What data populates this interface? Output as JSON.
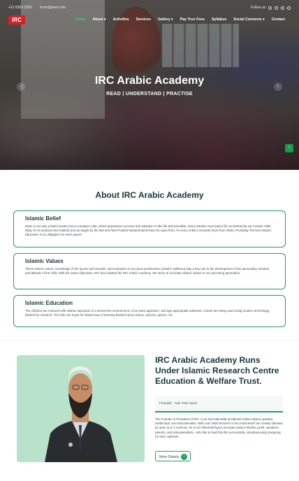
{
  "topbar": {
    "phone": "+91 8369 2350",
    "email": "ircsm@web.com",
    "follow_label": "Follow us"
  },
  "nav": {
    "logo_text": "IRC",
    "items": [
      "Home",
      "About ▾",
      "Activities",
      "Services",
      "Gallery ▾",
      "Pay Your Fees",
      "Syllabus",
      "Social Connects ▾",
      "Contact"
    ]
  },
  "hero": {
    "title": "IRC Arabic Academy",
    "subtitle": "READ | UNDERSTAND | PRACTISE",
    "prev": "‹",
    "next": "›",
    "scroll_top": "↑"
  },
  "about": {
    "title": "About IRC Arabic Academy",
    "cards": [
      {
        "title": "Islamic Belief",
        "text": "Islam is not only a belief system but a complete code, which guarantees success and salvation in this life and hereafter. Every Muslim must lead a life as desired by our Creator Allah (May He be praised and exalted) and as taught by the last and final Prophet Muhammad (Peace be upon him). As every child is Umanah (trust from Allah), Providing The best Islamic Education is an obligation for each parent."
      },
      {
        "title": "Islamic Values",
        "text": "These Islamic values, knowledge of the Quran and Sunnah, and examples of our pious predecessor (salaf-e saliheen) play a key role in the development of the personality, mindset, and attitude of the child. With the same objectives, IRC has initiated the IRC Arabic Academy. We strive to inculcate Islamic values in our upcoming generation."
      },
      {
        "title": "Islamic Education",
        "text": "The children are nurtured with Islamic education in a stress-free environment, a fun learn approach, and age-appropriate authentic content are being used using modern technology, backed by research. The kids can enjoy fun based way of learning backed up by videos, quizzes, games, etc."
      }
    ]
  },
  "founder": {
    "heading": "IRC Arabic Academy Runs Under Islamic Research Centre Education & Welfare Trust.",
    "tag": "Founder - Adv. Faiz Syed",
    "text": "The Founder & President of IRC, is an internationally acclaimed Indian Islamic speaker, intellectual, and educationalist. With over 2000 lectures to his credit which are closely followed by open Q & A sessions, he is an influential figure amongst today's Muslim youth, speakers, parents, and educationalists - who like to lead this life successfully, simultaneously preparing for their Aakhirah.",
    "button": "More Details",
    "button_icon": "›"
  }
}
